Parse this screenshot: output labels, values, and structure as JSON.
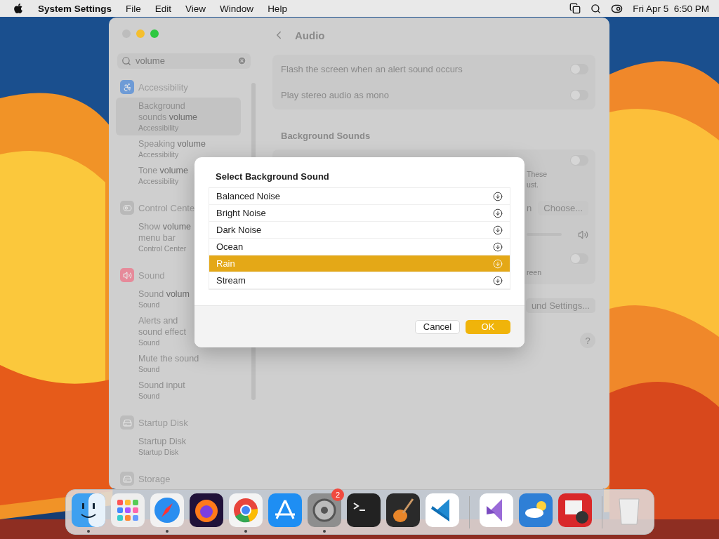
{
  "menubar": {
    "app": "System Settings",
    "menus": [
      "File",
      "Edit",
      "View",
      "Window",
      "Help"
    ],
    "clock": "Fri Apr 5  6:50 PM"
  },
  "window": {
    "title": "Audio",
    "search": {
      "value": "volume"
    },
    "sidebar": {
      "groups": [
        {
          "title": "Accessibility",
          "items": [
            {
              "label": "Background\nsounds **volume**",
              "subtitle": "Accessibility",
              "selected": true
            },
            {
              "label": "Speaking **volume**",
              "subtitle": "Accessibility",
              "selected": false
            },
            {
              "label": "Tone **volume**",
              "subtitle": "Accessibility",
              "selected": false
            }
          ]
        },
        {
          "title": "Control Cente",
          "items": [
            {
              "label": "Show **volume**\nmenu bar",
              "subtitle": "Control Center",
              "selected": false
            }
          ]
        },
        {
          "title": "Sound",
          "items": [
            {
              "label": "Sound **volum**",
              "subtitle": "Sound",
              "selected": false
            },
            {
              "label": "Alerts and\nsound effect",
              "subtitle": "Sound",
              "selected": false
            },
            {
              "label": "Mute the sound",
              "subtitle": "Sound",
              "selected": false
            },
            {
              "label": "Sound input",
              "subtitle": "Sound",
              "selected": false
            }
          ]
        },
        {
          "title": "Startup Disk",
          "items": [
            {
              "label": "Startup Disk",
              "subtitle": "Startup Disk",
              "selected": false
            }
          ]
        },
        {
          "title": "Storage"
        }
      ]
    },
    "settings": [
      {
        "kind": "toggle",
        "label": "Flash the screen when an alert sound occurs",
        "on": false
      },
      {
        "kind": "toggle",
        "label": "Play stereo audio as mono",
        "on": false
      }
    ],
    "background_sounds": {
      "heading": "Background Sounds",
      "rows": [
        {
          "kind": "toggle",
          "on": false,
          "notes": [
            "These",
            "ust."
          ]
        },
        {
          "kind": "button",
          "note": "n",
          "button": "Choose..."
        },
        {
          "kind": "slider"
        },
        {
          "kind": "toggle",
          "on": false,
          "notes": [
            "reen"
          ]
        }
      ]
    },
    "settings_button": "und Settings...",
    "help_button": "?"
  },
  "dialog": {
    "title": "Select Background Sound",
    "options": [
      {
        "label": "Balanced Noise",
        "selected": false
      },
      {
        "label": "Bright Noise",
        "selected": false
      },
      {
        "label": "Dark Noise",
        "selected": false
      },
      {
        "label": "Ocean",
        "selected": false
      },
      {
        "label": "Rain",
        "selected": true
      },
      {
        "label": "Stream",
        "selected": false
      }
    ],
    "buttons": [
      {
        "label": "Cancel",
        "kind": "secondary"
      },
      {
        "label": "OK",
        "kind": "primary"
      }
    ]
  },
  "dock": {
    "items": [
      {
        "kind": "finder",
        "running": true
      },
      {
        "kind": "launchpad",
        "running": false
      },
      {
        "kind": "safari",
        "running": true
      },
      {
        "kind": "firefox",
        "running": false
      },
      {
        "kind": "chrome",
        "running": true
      },
      {
        "kind": "appstore",
        "running": false
      },
      {
        "kind": "settings",
        "running": true,
        "badge": "2"
      },
      {
        "kind": "terminal",
        "running": false
      },
      {
        "kind": "garageband",
        "running": false
      },
      {
        "kind": "vscode",
        "running": false
      },
      {
        "kind": "separator"
      },
      {
        "kind": "visualstudio",
        "running": false
      },
      {
        "kind": "weather",
        "running": false
      },
      {
        "kind": "photobooth",
        "running": false
      },
      {
        "kind": "separator"
      },
      {
        "kind": "trash",
        "running": false
      }
    ]
  }
}
